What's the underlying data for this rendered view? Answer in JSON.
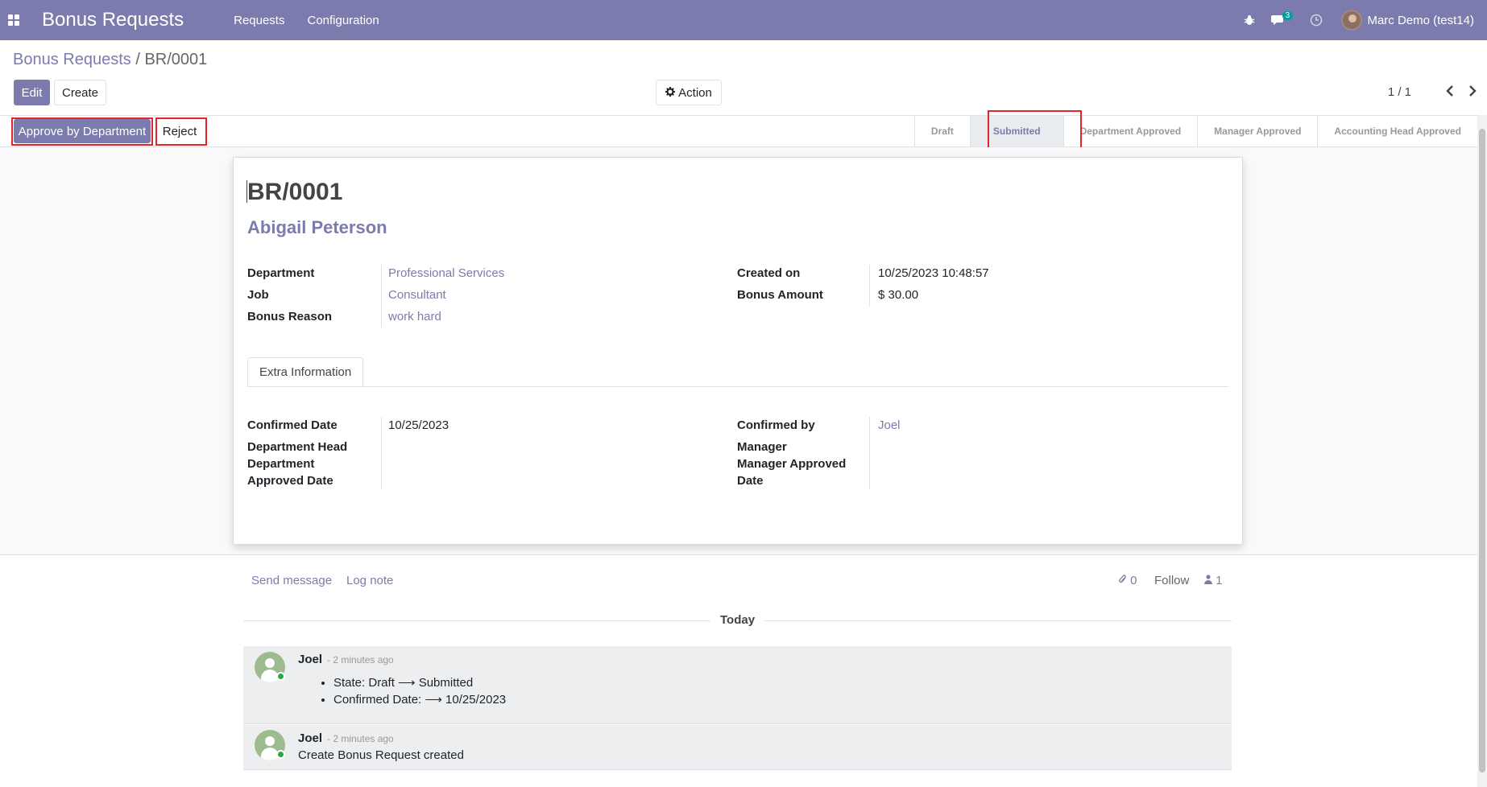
{
  "navbar": {
    "app_title": "Bonus Requests",
    "menu": [
      "Requests",
      "Configuration"
    ],
    "messages_count": "3",
    "user_name": "Marc Demo (test14)"
  },
  "breadcrumb": {
    "parent": "Bonus Requests",
    "separator": "/",
    "current": "BR/0001"
  },
  "controls": {
    "edit": "Edit",
    "create": "Create",
    "action": "Action",
    "pager": "1 / 1"
  },
  "header_buttons": {
    "approve": "Approve by Department",
    "reject": "Reject"
  },
  "stages": [
    "Draft",
    "Submitted",
    "Department Approved",
    "Manager Approved",
    "Accounting Head Approved"
  ],
  "active_stage": "Submitted",
  "record": {
    "name": "BR/0001",
    "employee": "Abigail Peterson",
    "department_label": "Department",
    "department": "Professional Services",
    "job_label": "Job",
    "job": "Consultant",
    "reason_label": "Bonus Reason",
    "reason": "work hard",
    "created_label": "Created on",
    "created": "10/25/2023 10:48:57",
    "amount_label": "Bonus Amount",
    "amount": "$ 30.00"
  },
  "tab": {
    "label": "Extra Information"
  },
  "extra": {
    "confirmed_date_label": "Confirmed Date",
    "confirmed_date": "10/25/2023",
    "dept_head_label": "Department Head",
    "dept_approved_label_1": "Department",
    "dept_approved_label_2": "Approved Date",
    "confirmed_by_label": "Confirmed by",
    "confirmed_by": "Joel",
    "manager_label": "Manager",
    "manager_approved_label_1": "Manager Approved",
    "manager_approved_label_2": "Date"
  },
  "chatter": {
    "send_message": "Send message",
    "log_note": "Log note",
    "attachments": "0",
    "follow": "Follow",
    "followers": "1",
    "today": "Today",
    "messages": [
      {
        "author": "Joel",
        "time": "- 2 minutes ago",
        "tracking": [
          "State: Draft ⟶ Submitted",
          "Confirmed Date: ⟶ 10/25/2023"
        ]
      },
      {
        "author": "Joel",
        "time": "- 2 minutes ago",
        "body": "Create Bonus Request created"
      }
    ]
  }
}
